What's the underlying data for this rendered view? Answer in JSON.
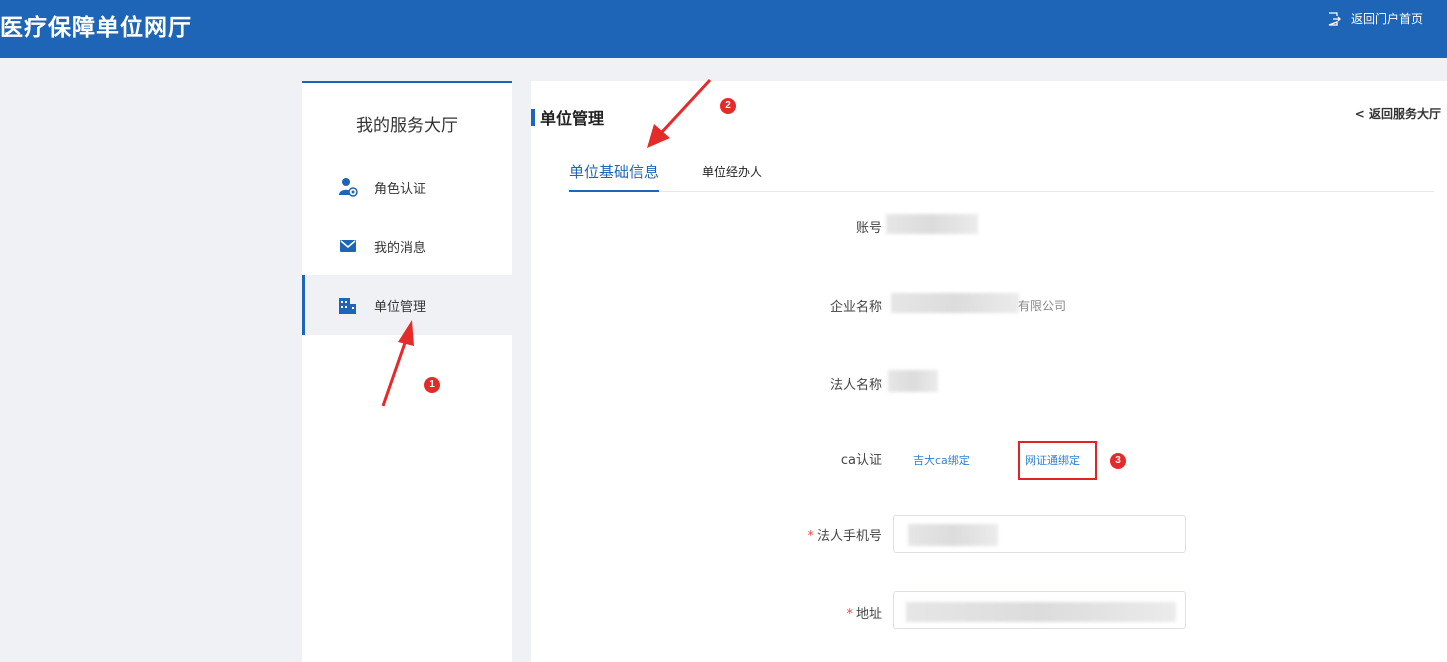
{
  "header": {
    "title": "医疗保障单位网厅",
    "portal_link": "返回门户首页",
    "portal_icon": "exit-icon"
  },
  "sidebar": {
    "title": "我的服务大厅",
    "items": [
      {
        "label": "角色认证",
        "icon": "user-cert-icon"
      },
      {
        "label": "我的消息",
        "icon": "mail-icon"
      },
      {
        "label": "单位管理",
        "icon": "building-icon",
        "active": true
      }
    ]
  },
  "main": {
    "title": "单位管理",
    "back_link": "< 返回服务大厅",
    "tabs": [
      {
        "label": "单位基础信息",
        "active": true
      },
      {
        "label": "单位经办人"
      }
    ],
    "form": {
      "account_label": "账号",
      "company_label": "企业名称",
      "company_value_suffix": "有限公司",
      "legal_label": "法人名称",
      "ca_label": "ca认证",
      "ca_option_1": "吉大ca绑定",
      "ca_option_2": "网证通绑定",
      "phone_required": "*",
      "phone_label": "法人手机号",
      "address_required": "*",
      "address_label": "地址"
    }
  },
  "annotations": {
    "markers": [
      "1",
      "2",
      "3"
    ]
  },
  "colors": {
    "brand": "#1f65b7",
    "marker_red": "#e52a2a",
    "link_blue": "#2f7fd6"
  }
}
